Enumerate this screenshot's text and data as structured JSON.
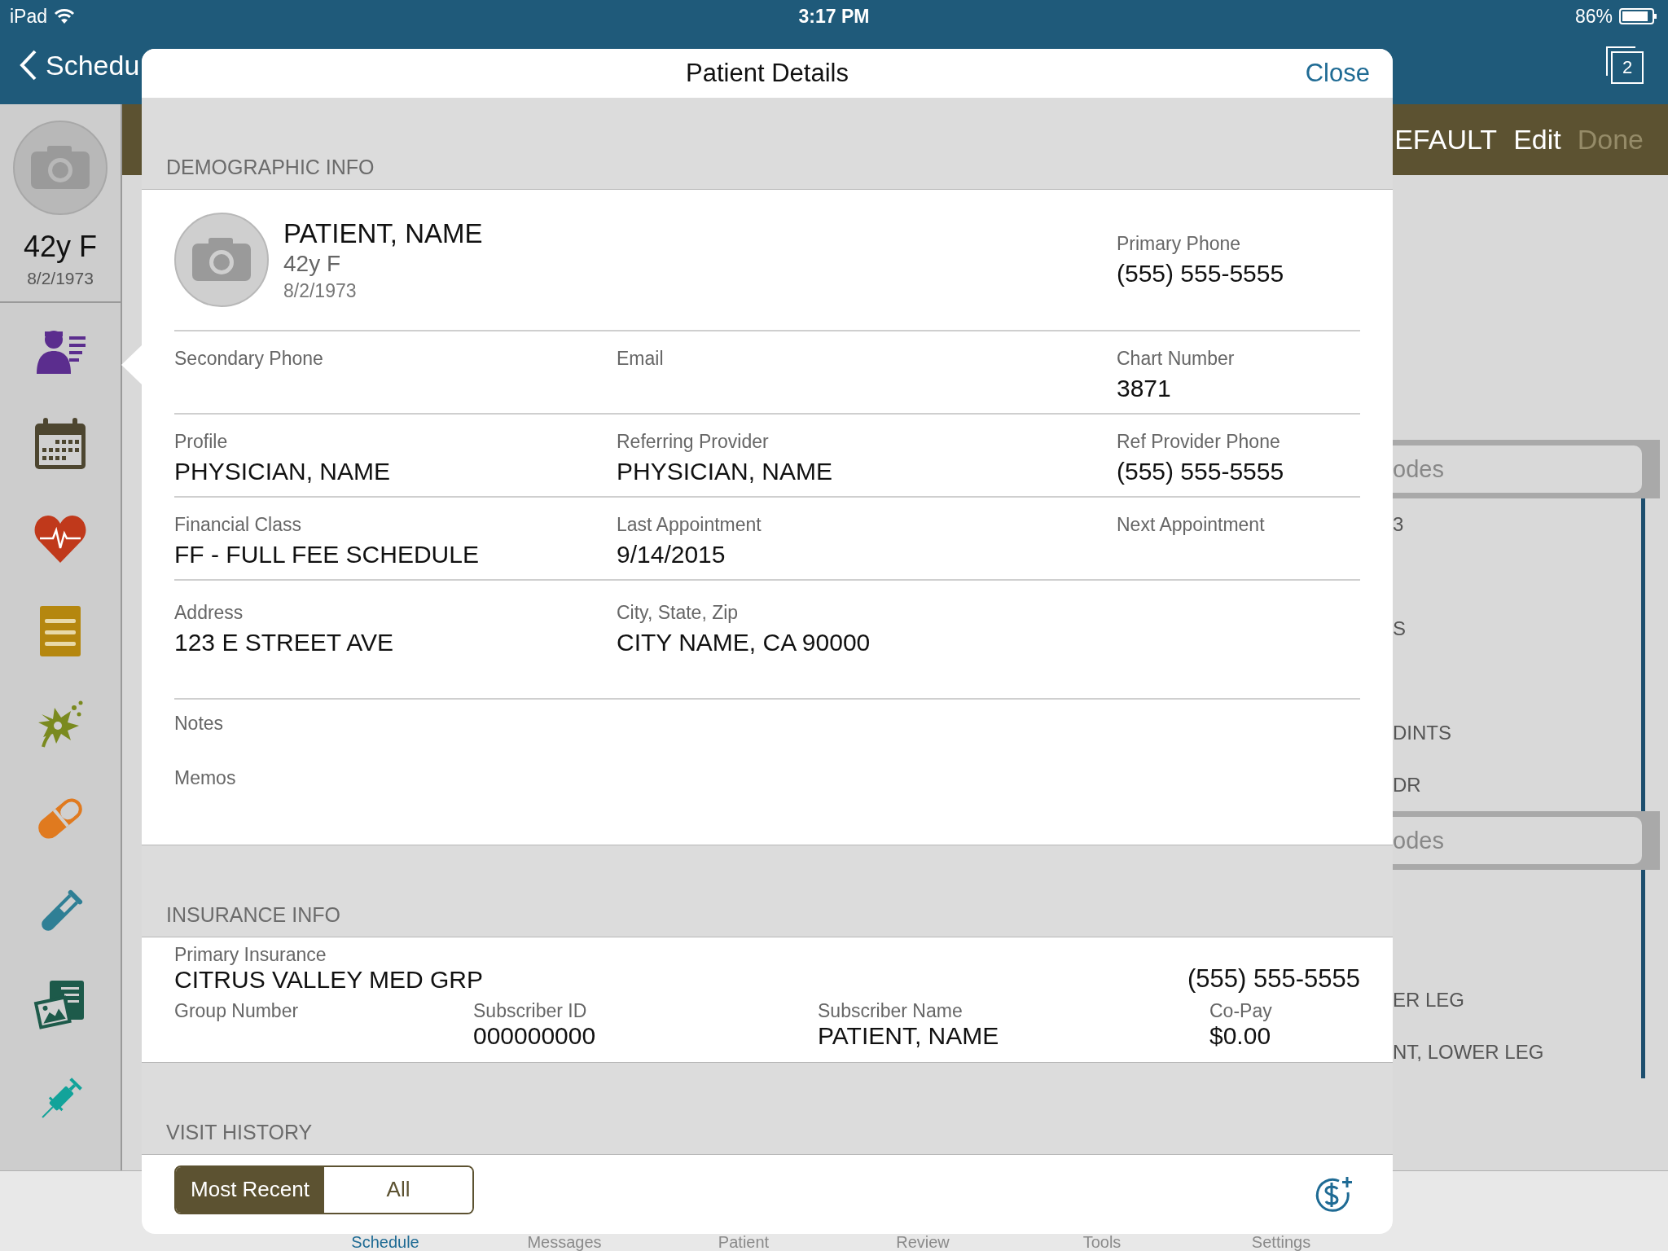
{
  "status_bar": {
    "device": "iPad",
    "time": "3:17 PM",
    "battery": "86%"
  },
  "nav_bar": {
    "back_label": "Schedu",
    "window_count": "2"
  },
  "toolbar": {
    "title": "EFAULT",
    "actions": [
      {
        "label": "Edit",
        "disabled": false
      },
      {
        "label": "Done",
        "disabled": true
      }
    ]
  },
  "sidebar": {
    "age_sex": "42y F",
    "dob": "8/2/1973",
    "items": [
      {
        "kind": "demographics"
      },
      {
        "kind": "calendar"
      },
      {
        "kind": "vitals"
      },
      {
        "kind": "notes"
      },
      {
        "kind": "allergies"
      },
      {
        "kind": "medications"
      },
      {
        "kind": "labs"
      },
      {
        "kind": "images"
      },
      {
        "kind": "injections"
      }
    ]
  },
  "background_list": [
    {
      "kind": "header",
      "text": "odes"
    },
    {
      "kind": "row",
      "text": "3"
    },
    {
      "kind": "row"
    },
    {
      "kind": "row",
      "text": "S"
    },
    {
      "kind": "row"
    },
    {
      "kind": "row",
      "text": "DINTS"
    },
    {
      "kind": "row",
      "text": "DR"
    },
    {
      "kind": "header",
      "text": "odes"
    },
    {
      "kind": "row"
    },
    {
      "kind": "row"
    },
    {
      "kind": "row",
      "text": "ER LEG"
    },
    {
      "kind": "row",
      "text": "NT, LOWER LEG"
    }
  ],
  "tab_bar": [
    {
      "label": "Schedule",
      "selected": true
    },
    {
      "label": "Messages",
      "selected": false
    },
    {
      "label": "Patient",
      "selected": false
    },
    {
      "label": "Review",
      "selected": false
    },
    {
      "label": "Tools",
      "selected": false
    },
    {
      "label": "Settings",
      "selected": false
    }
  ],
  "modal": {
    "title": "Patient Details",
    "close": "Close",
    "demographic": {
      "heading": "DEMOGRAPHIC INFO",
      "patient": {
        "name": "PATIENT, NAME",
        "age_sex": "42y F",
        "dob": "8/2/1973"
      },
      "primary_phone": {
        "label": "Primary Phone",
        "value": "(555) 555-5555"
      },
      "rows": [
        [
          {
            "label": "Secondary Phone"
          },
          {
            "label": "Email"
          },
          {
            "label": "Chart Number",
            "value": "3871"
          }
        ],
        [
          {
            "label": "Profile",
            "value": "PHYSICIAN, NAME"
          },
          {
            "label": "Referring Provider",
            "value": "PHYSICIAN, NAME"
          },
          {
            "label": "Ref Provider Phone",
            "value": "(555) 555-5555"
          }
        ],
        [
          {
            "label": "Financial Class",
            "value": "FF - FULL FEE SCHEDULE"
          },
          {
            "label": "Last Appointment",
            "value": "9/14/2015"
          },
          {
            "label": "Next Appointment"
          }
        ],
        [
          {
            "label": "Address",
            "value": "123 E STREET AVE"
          },
          {
            "label": "City, State, Zip",
            "value": "CITY NAME, CA 90000"
          }
        ]
      ],
      "notes": [
        "Notes",
        "Memos"
      ]
    },
    "insurance": {
      "heading": "INSURANCE INFO",
      "primary": {
        "label": "Primary Insurance",
        "value": "CITRUS VALLEY MED GRP",
        "phone": "(555) 555-5555"
      },
      "fields": [
        {
          "label": "Group Number"
        },
        {
          "label": "Subscriber ID",
          "value": "000000000"
        },
        {
          "label": "Subscriber Name",
          "value": "PATIENT, NAME"
        },
        {
          "label": "Co-Pay",
          "value": "$0.00"
        }
      ]
    },
    "visit_history": {
      "heading": "VISIT HISTORY",
      "segments": [
        {
          "label": "Most Recent",
          "selected": true
        },
        {
          "label": "All",
          "selected": false
        }
      ]
    }
  }
}
